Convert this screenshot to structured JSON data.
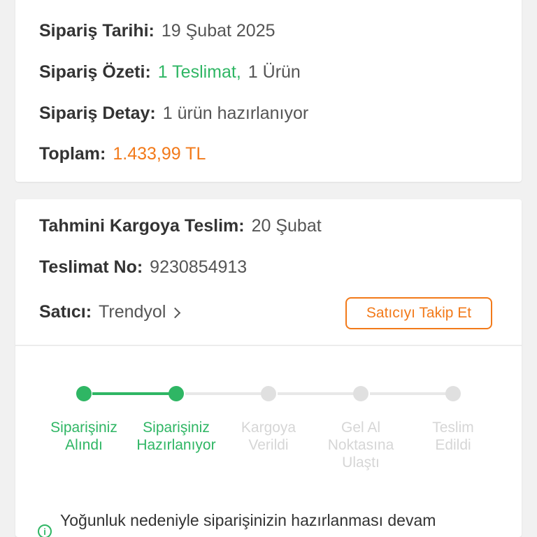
{
  "summary": {
    "date_label": "Sipariş Tarihi:",
    "date_value": "19 Şubat 2025",
    "overview_label": "Sipariş Özeti:",
    "overview_deliveries": "1 Teslimat,",
    "overview_items": "1 Ürün",
    "detail_label": "Sipariş Detay:",
    "detail_value": "1 ürün hazırlanıyor",
    "total_label": "Toplam:",
    "total_value": "1.433,99 TL"
  },
  "delivery": {
    "estimate_label": "Tahmini Kargoya Teslim:",
    "estimate_value": "20 Şubat",
    "number_label": "Teslimat No:",
    "number_value": "9230854913",
    "seller_label": "Satıcı:",
    "seller_value": "Trendyol",
    "follow_button": "Satıcıyı Takip Et"
  },
  "tracker": {
    "steps": [
      {
        "line1": "Siparişiniz",
        "line2": "Alındı",
        "line3": "",
        "status": "done"
      },
      {
        "line1": "Siparişiniz",
        "line2": "Hazırlanıyor",
        "line3": "",
        "status": "done"
      },
      {
        "line1": "Kargoya",
        "line2": "Verildi",
        "line3": "",
        "status": "pending"
      },
      {
        "line1": "Gel Al",
        "line2": "Noktasına",
        "line3": "Ulaştı",
        "status": "pending"
      },
      {
        "line1": "Teslim",
        "line2": "Edildi",
        "line3": "",
        "status": "pending"
      }
    ]
  },
  "notice": {
    "text": "Yoğunluk nedeniyle siparişinizin hazırlanması devam",
    "icon": "info-icon"
  },
  "colors": {
    "accent_green": "#2fb664",
    "accent_orange": "#f27a1a",
    "pending_grey": "#e0e0e0"
  }
}
